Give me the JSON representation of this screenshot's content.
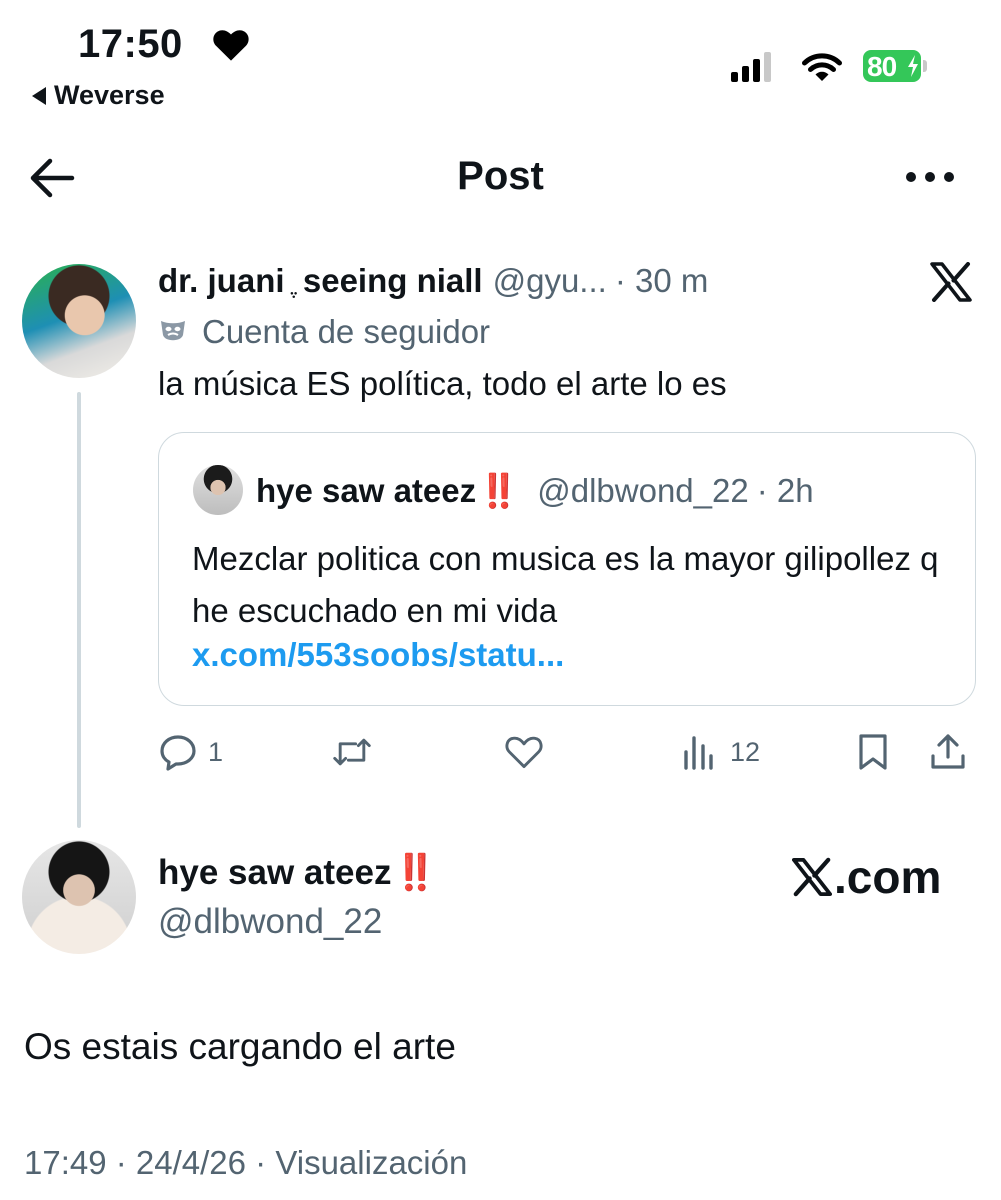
{
  "status_bar": {
    "time": "17:50",
    "back_app": "Weverse",
    "battery_percent": "80",
    "battery_color": "#34c759"
  },
  "header": {
    "title": "Post"
  },
  "thread_tweet": {
    "display_name": "dr. juani ֶ seeing niall",
    "handle": "@gyu...",
    "time": "· 30 m",
    "account_label": "Cuenta de seguidor",
    "text": "la música ES política, todo el arte lo es",
    "quote": {
      "display_name": "hye saw ateez",
      "emoji": "‼️",
      "handle": "@dlbwond_22",
      "time": "· 2h",
      "text": "Mezclar politica con musica es la mayor gilipollez q he escuchado en mi vida",
      "link": "x.com/553soobs/statu..."
    },
    "actions": {
      "replies": "1",
      "views": "12"
    }
  },
  "main_tweet": {
    "display_name": "hye saw ateez",
    "emoji": "‼️",
    "handle": "@dlbwond_22",
    "watermark": ".com",
    "text": "Os estais cargando el arte",
    "meta": "17:49 · 24/4/26 · Visualización"
  },
  "colors": {
    "accent_link": "#1d9bf0",
    "secondary_text": "#536471",
    "emoji_red": "#e0211b"
  },
  "icons": [
    "heart-icon",
    "signal-icon",
    "wifi-icon",
    "battery-icon",
    "back-arrow-icon",
    "more-icon",
    "x-logo-icon",
    "mask-icon",
    "reply-icon",
    "retweet-icon",
    "like-icon",
    "views-icon",
    "bookmark-icon",
    "share-icon"
  ]
}
